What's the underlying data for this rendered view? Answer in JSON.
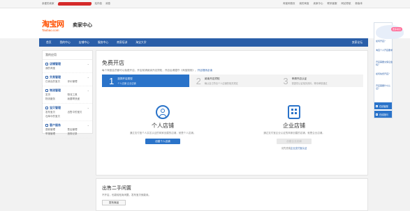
{
  "topbar": {
    "left_label": "亲爱的卖家",
    "left_links": [
      "站内信",
      "消息"
    ],
    "right_links": [
      "淘宝网首页",
      "我的淘宝",
      "卖家中心",
      "联系客服",
      "网站导航",
      "新版本"
    ]
  },
  "header": {
    "logo_cn": "淘宝网",
    "logo_en": "Taobao.com",
    "center": "卖家中心"
  },
  "nav": {
    "items": [
      "首页",
      "我的中心",
      "店铺中心",
      "服务中心",
      "商家培训",
      "淘宝大学"
    ],
    "right": "卖家论坛"
  },
  "sidebar": {
    "title": "我的应用",
    "groups": [
      {
        "title": "店铺管理",
        "links": [
          "我的淘宝",
          "",
          "",
          ""
        ]
      },
      {
        "title": "交易管理",
        "links": [
          "已卖出的宝贝",
          "评价管理"
        ]
      },
      {
        "title": "物流管理",
        "links": [
          "发货",
          "物流工具",
          "物流服务",
          "我要寄快递"
        ]
      },
      {
        "title": "宝贝管理",
        "links": [
          "发布宝贝",
          "出售中的宝贝",
          "仓库中的宝贝",
          ""
        ]
      },
      {
        "title": "客户服务",
        "links": [
          "退款管理",
          "售后管理",
          "举报管理",
          "违规记录"
        ]
      }
    ]
  },
  "main": {
    "title": "免费开店",
    "hint": "每个淘宝会员都可以免费开店，开店前请阅读开店须知，开店后请遵守《淘宝规则》。",
    "hint_link": "开店规则必读",
    "steps": [
      {
        "num": "1",
        "title": "选择开店类型",
        "desc": "个人店铺 企业店铺"
      },
      {
        "num": "2",
        "title": "阅读开店须知",
        "desc": "确认自己符合个人店铺的相关规定"
      },
      {
        "num": "3",
        "title": "申请开店认证",
        "desc": "需提供认证相关资料，等待审核通过"
      }
    ],
    "cards": [
      {
        "name": "个人店铺",
        "desc": "通过支付宝个人实名认证的商家创建的店铺，就是个人店铺。",
        "button": "创建个人店铺",
        "enabled": true
      },
      {
        "name": "企业店铺",
        "desc": "通过支付宝企业认证的商家创建的店铺，就是企业店铺。",
        "button": "创建企业店铺",
        "enabled": false,
        "sub_prefix": "请先完成",
        "sub_link": "企业支付宝认证"
      }
    ]
  },
  "second": {
    "title": "出售二手闲置",
    "desc": "不开店，也能轻松卖闲置，发布宝贝就能卖。",
    "button": "发布商品"
  },
  "float": {
    "badge": "更多常见",
    "questions": [
      "如何开店？",
      "淘宝个人开店要求",
      "开店需要交保证金吗？",
      "如何免费开店？",
      "开店需要什么认证？"
    ],
    "tools": [
      "在线客服",
      "在线提问"
    ]
  },
  "colors": {
    "brand": "#ff5000",
    "nav": "#2a5ea8",
    "accent": "#2a73c9"
  }
}
